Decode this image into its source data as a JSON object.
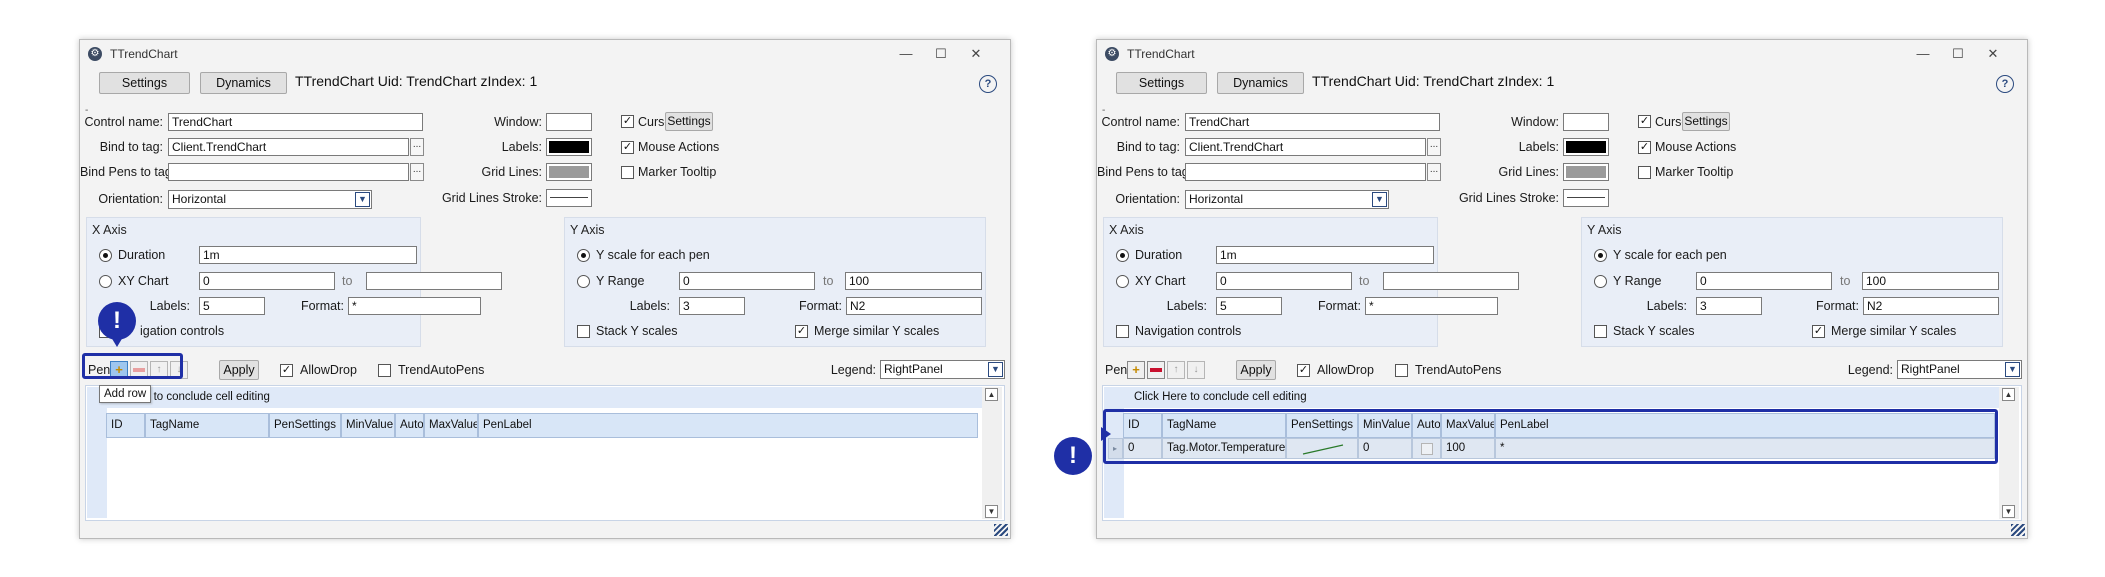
{
  "window": {
    "title": "TTrendChart",
    "controls": {
      "minimize": "—",
      "maximize": "☐",
      "close": "✕"
    },
    "settings_tab": "Settings",
    "dynamics_tab": "Dynamics",
    "heading": "TTrendChart Uid: TrendChart zIndex: 1",
    "help": "?",
    "dash": "-"
  },
  "form": {
    "control_name_label": "Control name:",
    "control_name_value": "TrendChart",
    "bind_tag_label": "Bind to tag:",
    "bind_tag_value": "Client.TrendChart",
    "bind_pens_label": "Bind Pens to tag:",
    "bind_pens_value": "",
    "browse": "...",
    "orientation_label": "Orientation:",
    "orientation_value": "Horizontal",
    "window_label": "Window:",
    "labels_label": "Labels:",
    "grid_lines_label": "Grid Lines:",
    "grid_stroke_label": "Grid Lines Stroke:",
    "cursor_label": "Cursor",
    "cursor_settings": "Settings",
    "mouse_actions_label": "Mouse Actions",
    "marker_tooltip_label": "Marker Tooltip"
  },
  "colors": {
    "window_swatch": "#ffffff",
    "labels_swatch": "#000000",
    "grid_swatch": "#9a9a9a",
    "highlight": "#1f2fa6"
  },
  "xaxis": {
    "title": "X Axis",
    "duration_label": "Duration",
    "duration_value": "1m",
    "xy_label": "XY Chart",
    "xy_from": "0",
    "to": "to",
    "xy_to": "",
    "labels_label": "Labels:",
    "labels_value": "5",
    "format_label": "Format:",
    "format_value": "*",
    "nav_label": "Navigation controls",
    "nav_label_partial": "igation controls"
  },
  "yaxis": {
    "title": "Y Axis",
    "yscale_label": "Y scale for each pen",
    "yrange_label": "Y Range",
    "yrange_from": "0",
    "to": "to",
    "yrange_to": "100",
    "labels_label": "Labels:",
    "labels_value": "3",
    "format_label": "Format:",
    "format_value": "N2",
    "stack_label": "Stack Y scales",
    "merge_label": "Merge similar Y scales"
  },
  "pens": {
    "label": "Pens",
    "add_icon": "+",
    "up_icon": "↑",
    "down_icon": "↓",
    "apply": "Apply",
    "allowdrop_label": "AllowDrop",
    "trendautopens_label": "TrendAutoPens",
    "legend_label": "Legend:",
    "legend_value": "RightPanel",
    "tooltip": "Add row"
  },
  "grid": {
    "conclude": "Click Here to conclude cell editing",
    "conclude_partial": "e to conclude cell editing",
    "columns": [
      "ID",
      "TagName",
      "PenSettings",
      "MinValue",
      "Auto",
      "MaxValue",
      "PenLabel"
    ],
    "row": {
      "id": "0",
      "tagname": "Tag.Motor.Temperature",
      "minvalue": "0",
      "maxvalue": "100",
      "penlabel": "*"
    }
  },
  "marker": "!"
}
